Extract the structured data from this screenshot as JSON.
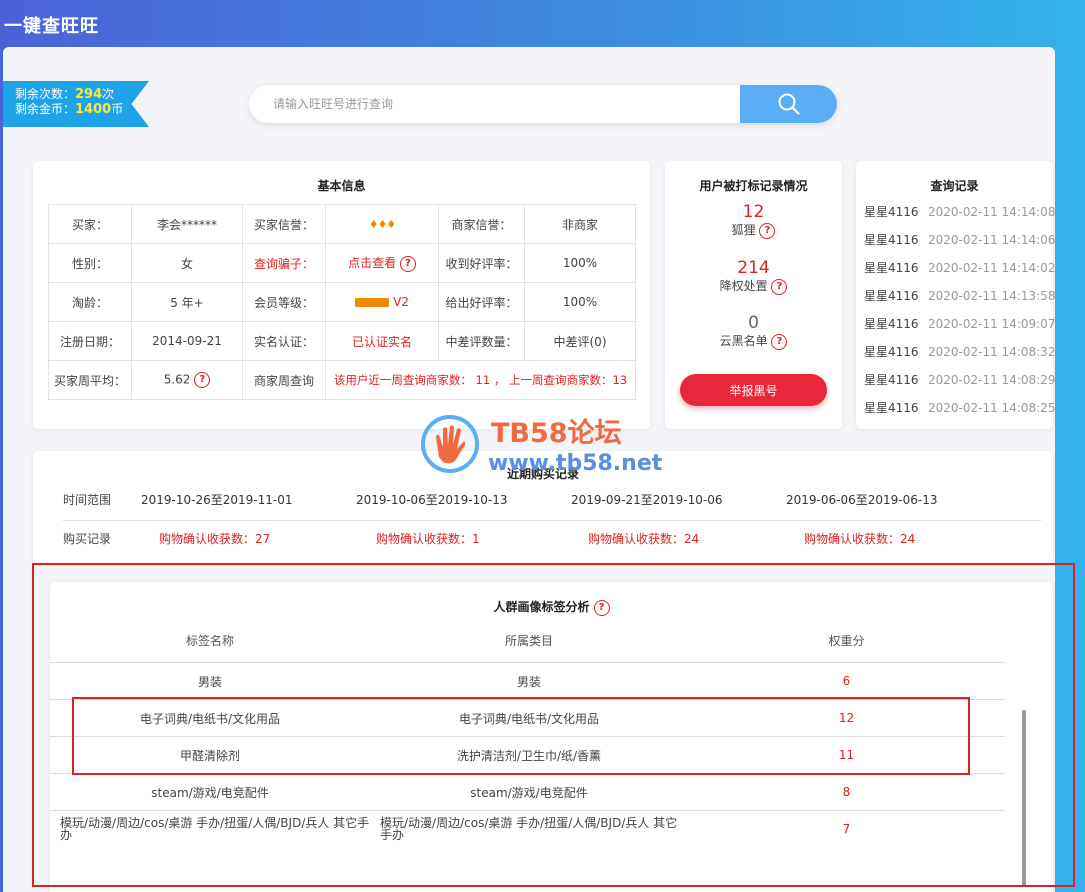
{
  "app": {
    "title": "一键查旺旺"
  },
  "ribbon": {
    "remaining_count_label": "剩余次数：",
    "remaining_count": "294",
    "count_unit": "次",
    "remaining_coins_label": "剩余金币：",
    "remaining_coins": "1400",
    "coin_unit": "币"
  },
  "search": {
    "placeholder": "请输入旺旺号进行查询"
  },
  "basic_info": {
    "title": "基本信息",
    "rows": [
      [
        "买家：",
        "李会******",
        "买家信誉：",
        "",
        "商家信誉：",
        "非商家"
      ],
      [
        "性别：",
        "女",
        "查询骗子：",
        "点击查看",
        "收到好评率：",
        "100%"
      ],
      [
        "淘龄：",
        "5 年+",
        "会员等级：",
        "V2",
        "给出好评率：",
        "100%"
      ],
      [
        "注册日期：",
        "2014-09-21",
        "实名认证：",
        "已认证实名",
        "中差评数量：",
        "中差评(0)"
      ],
      [
        "买家周平均：",
        "5.62",
        "商家周查询",
        "该用户近一周查询商家数： 11 ， 上一周查询商家数：13"
      ]
    ]
  },
  "flag_stats": {
    "title": "用户被打标记录情况",
    "items": [
      {
        "value": "12",
        "label": "狐狸"
      },
      {
        "value": "214",
        "label": "降权处置"
      },
      {
        "value": "0",
        "label": "云黑名单"
      }
    ],
    "report_button": "举报黑号"
  },
  "query_history": {
    "title": "查询记录",
    "items": [
      {
        "name": "星星4116",
        "time": "2020-02-11 14:14:08"
      },
      {
        "name": "星星4116",
        "time": "2020-02-11 14:14:06"
      },
      {
        "name": "星星4116",
        "time": "2020-02-11 14:14:02"
      },
      {
        "name": "星星4116",
        "time": "2020-02-11 14:13:58"
      },
      {
        "name": "星星4116",
        "time": "2020-02-11 14:09:07"
      },
      {
        "name": "星星4116",
        "time": "2020-02-11 14:08:32"
      },
      {
        "name": "星星4116",
        "time": "2020-02-11 14:08:29"
      },
      {
        "name": "星星4116",
        "time": "2020-02-11 14:08:25"
      }
    ]
  },
  "watermark": {
    "line1": "TB58论坛",
    "line2": "www.tb58.net"
  },
  "purchase": {
    "title": "近期购买记录",
    "range_label": "时间范围",
    "record_label": "购买记录",
    "ranges": [
      "2019-10-26至2019-11-01",
      "2019-10-06至2019-10-13",
      "2019-09-21至2019-10-06",
      "2019-06-06至2019-06-13"
    ],
    "records": [
      "购物确认收获数：27",
      "购物确认收获数：1",
      "购物确认收获数：24",
      "购物确认收获数：24"
    ]
  },
  "crowd": {
    "title": "人群画像标签分析",
    "columns": [
      "标签名称",
      "所属类目",
      "权重分"
    ],
    "rows": [
      [
        "男装",
        "男装",
        "6"
      ],
      [
        "电子词典/电纸书/文化用品",
        "电子词典/电纸书/文化用品",
        "12"
      ],
      [
        "甲醛清除剂",
        "洗护清洁剂/卫生巾/纸/香薰",
        "11"
      ],
      [
        "steam/游戏/电竞配件",
        "steam/游戏/电竞配件",
        "8"
      ],
      [
        "模玩/动漫/周边/cos/桌游 手办/扭蛋/人偶/BJD/兵人 其它手办",
        "模玩/动漫/周边/cos/桌游 手办/扭蛋/人偶/BJD/兵人 其它手办",
        "7"
      ]
    ]
  },
  "colors": {
    "accent_red": "#e02020",
    "search_blue": "#5aaef6",
    "ribbon_blue": "#1fa3e8"
  }
}
